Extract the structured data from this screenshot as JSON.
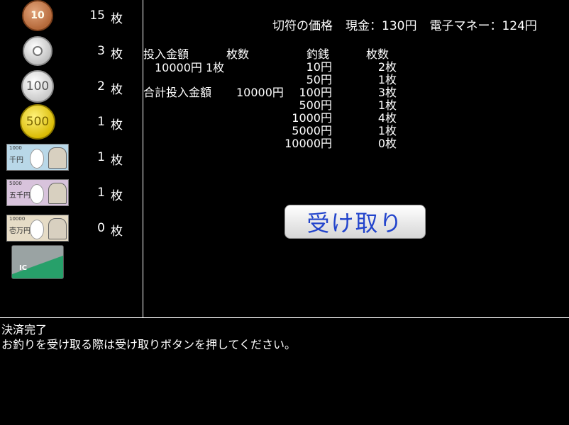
{
  "wallet": [
    {
      "kind": "10-yen-coin",
      "label": "10",
      "count": "15",
      "unit": "枚"
    },
    {
      "kind": "50-yen-coin",
      "label": "50",
      "count": "3",
      "unit": "枚"
    },
    {
      "kind": "100-yen-coin",
      "label": "100",
      "count": "2",
      "unit": "枚"
    },
    {
      "kind": "500-yen-coin",
      "label": "500",
      "count": "1",
      "unit": "枚"
    },
    {
      "kind": "1000-yen-note",
      "label": "千円",
      "den": "1000",
      "count": "1",
      "unit": "枚"
    },
    {
      "kind": "5000-yen-note",
      "label": "五千円",
      "den": "5000",
      "count": "1",
      "unit": "枚"
    },
    {
      "kind": "10000-yen-note",
      "label": "壱万円",
      "den": "10000",
      "count": "0",
      "unit": "枚"
    },
    {
      "kind": "ic-card",
      "label": "IC"
    }
  ],
  "price": {
    "label": "切符の価格",
    "cash": "現金：130円",
    "emoney": "電子マネー：124円"
  },
  "inserted": {
    "header_amount": "投入金額",
    "header_count": "枚数",
    "line": "10000円 1枚",
    "total_label": "合計投入金額",
    "total_value": "10000円"
  },
  "change": {
    "header_denom": "釣銭",
    "header_count": "枚数",
    "rows": [
      {
        "denom": "10円",
        "count": "2枚"
      },
      {
        "denom": "50円",
        "count": "1枚"
      },
      {
        "denom": "100円",
        "count": "3枚"
      },
      {
        "denom": "500円",
        "count": "1枚"
      },
      {
        "denom": "1000円",
        "count": "4枚"
      },
      {
        "denom": "5000円",
        "count": "1枚"
      },
      {
        "denom": "10000円",
        "count": "0枚"
      }
    ]
  },
  "receive_button": "受け取り",
  "messages": {
    "line1": "決済完了",
    "line2": "お釣りを受け取る際は受け取りボタンを押してください。"
  }
}
